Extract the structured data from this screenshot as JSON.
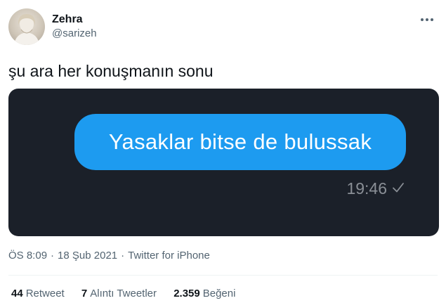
{
  "author": {
    "display_name": "Zehra",
    "handle": "@sarizeh"
  },
  "tweet": {
    "text": "şu ara her konuşmanın sonu"
  },
  "media": {
    "message_text": "Yasaklar bitse de bulussak",
    "message_time": "19:46",
    "bubble_color": "#1d9bf0",
    "background_color": "#1b2029"
  },
  "meta": {
    "time": "ÖS 8:09",
    "date": "18 Şub 2021",
    "source": "Twitter for iPhone",
    "separator": "·"
  },
  "stats": [
    {
      "count": "44",
      "label": "Retweet"
    },
    {
      "count": "7",
      "label": "Alıntı Tweetler"
    },
    {
      "count": "2.359",
      "label": "Beğeni"
    }
  ]
}
